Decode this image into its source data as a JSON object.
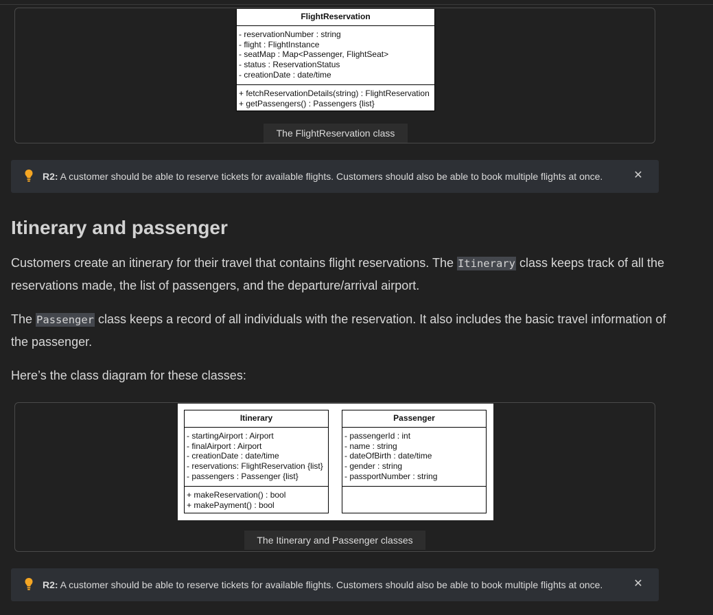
{
  "figure1": {
    "caption": "The FlightReservation class",
    "class": {
      "name": "FlightReservation",
      "attributes": [
        "- reservationNumber : string",
        "- flight : FlightInstance",
        "- seatMap : Map<Passenger, FlightSeat>",
        "- status : ReservationStatus",
        "- creationDate : date/time"
      ],
      "methods": [
        "+ fetchReservationDetails(string) : FlightReservation",
        "+ getPassengers() : Passengers {list}"
      ]
    }
  },
  "note": {
    "icon": "lightbulb-icon",
    "label": "R2:",
    "text": " A customer should be able to reserve tickets for available flights. Customers should also be able to book multiple flights at once.",
    "close": "✕",
    "accent": "#f5a623"
  },
  "section": {
    "heading": "Itinerary and passenger",
    "para1": {
      "before": "Customers create an itinerary for their travel that contains flight reservations. The ",
      "code": "Itinerary",
      "after": " class keeps track of all the reservations made, the list of passengers, and the departure/arrival airport."
    },
    "para2": {
      "before": "The ",
      "code": "Passenger",
      "after": " class keeps a record of all individuals with the reservation. It also includes the basic travel information of the passenger."
    },
    "para3": "Here’s the class diagram for these classes:"
  },
  "figure2": {
    "caption": "The Itinerary and Passenger classes",
    "itinerary": {
      "name": "Itinerary",
      "attributes": [
        "- startingAirport : Airport",
        "- finalAirport : Airport",
        "- creationDate : date/time",
        "- reservations: FlightReservation {list}",
        "- passengers : Passenger {list}"
      ],
      "methods": [
        "+ makeReservation() : bool",
        "+ makePayment() : bool"
      ]
    },
    "passenger": {
      "name": "Passenger",
      "attributes": [
        "- passengerId : int",
        "- name : string",
        "- dateOfBirth : date/time",
        "- gender : string",
        "- passportNumber : string"
      ],
      "methods": []
    }
  }
}
